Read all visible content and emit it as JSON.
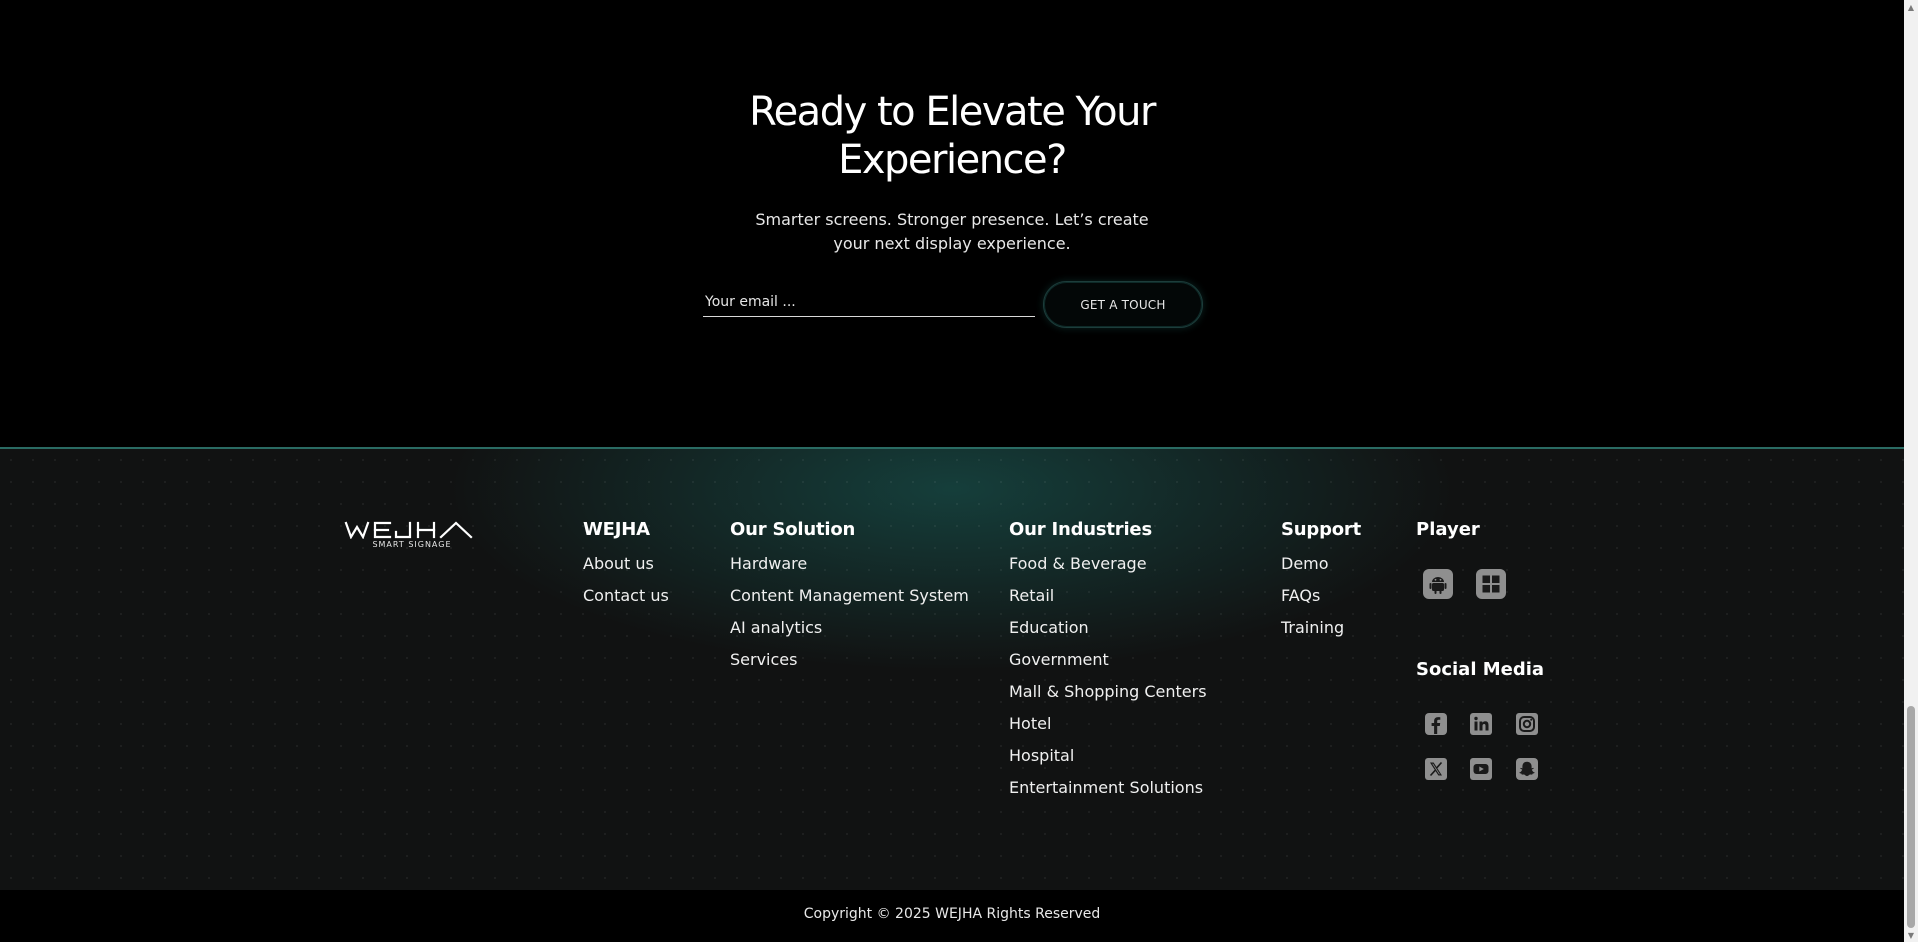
{
  "cta": {
    "title_line1": "Ready to Elevate Your",
    "title_line2": "Experience?",
    "subtitle_line1": "Smarter screens. Stronger presence. Let’s create",
    "subtitle_line2": "your next display experience.",
    "email_placeholder": "Your email ...",
    "button_label": "GET A TOUCH"
  },
  "footer": {
    "logo_text": "WEJHA",
    "logo_subtext": "SMART SIGNAGE",
    "columns": [
      {
        "title": "WEJHA",
        "items": [
          "About us",
          "Contact us"
        ]
      },
      {
        "title": "Our Solution",
        "items": [
          "Hardware",
          "Content Management System",
          "AI analytics",
          "Services"
        ]
      },
      {
        "title": "Our Industries",
        "items": [
          "Food & Beverage",
          "Retail",
          "Education",
          "Government",
          "Mall & Shopping Centers",
          "Hotel",
          "Hospital",
          "Entertainment Solutions"
        ]
      },
      {
        "title": "Support",
        "items": [
          "Demo",
          "FAQs",
          "Training"
        ]
      }
    ],
    "player": {
      "title": "Player",
      "icons": [
        "android-icon",
        "windows-icon"
      ]
    },
    "social": {
      "title": "Social Media",
      "icons": [
        "facebook-icon",
        "linkedin-icon",
        "instagram-icon",
        "x-icon",
        "youtube-icon",
        "snapchat-icon"
      ]
    },
    "copyright": "Copyright © 2025 WEJHA Rights Reserved"
  },
  "colors": {
    "accent_teal": "#2a6b63",
    "background": "#000000",
    "footer_bg": "#111212",
    "icon_gray": "#9a9a9a"
  }
}
